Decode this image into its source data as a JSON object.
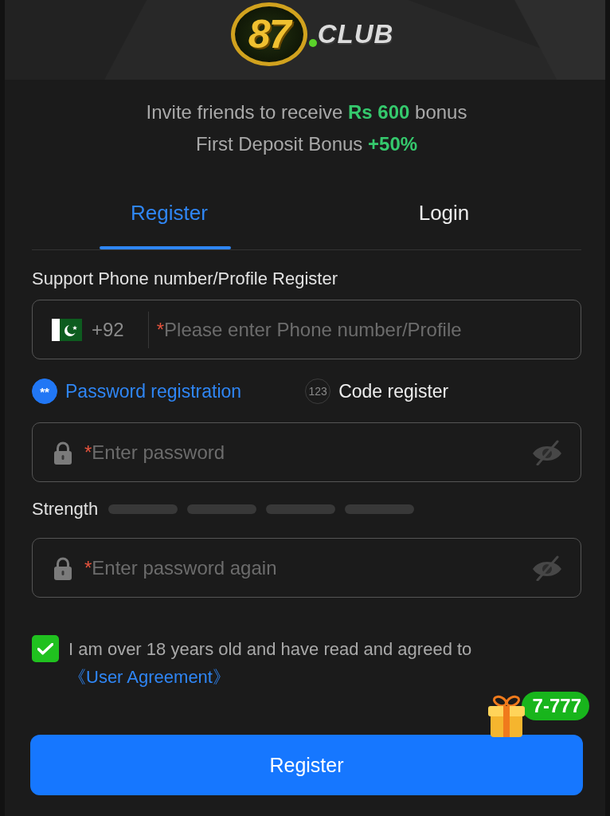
{
  "header": {
    "logo": {
      "number": "87",
      "word": "CLUB"
    }
  },
  "promo": [
    "Invite friends to receive **Rs 600** bonus",
    "First Deposit Bonus **+50%**"
  ],
  "tabs": [
    {
      "label": "Register",
      "selected": true
    },
    {
      "label": "Login",
      "selected": false
    }
  ],
  "phone": {
    "label": "Support Phone number/Profile Register",
    "country_code": "+92",
    "required_mark": "*",
    "placeholder": "Please enter Phone number/Profile"
  },
  "methods": [
    {
      "badge": "**",
      "label": "Password registration",
      "selected": true
    },
    {
      "badge": "123",
      "label": "Code register",
      "selected": false
    }
  ],
  "password": {
    "required_mark": "*",
    "placeholder": "Enter password"
  },
  "strength": {
    "label": "Strength"
  },
  "confirm_password": {
    "required_mark": "*",
    "placeholder": "Enter password again"
  },
  "agreement": {
    "checked": true,
    "text": "I am over 18 years old and have read and agreed to",
    "link": "《User Agreement》"
  },
  "gift_badge": {
    "label": "7-777"
  },
  "submit_button": {
    "label": "Register"
  }
}
